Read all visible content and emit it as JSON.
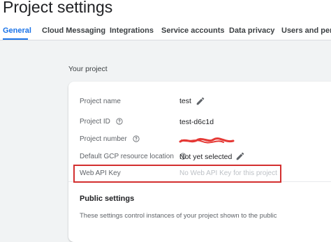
{
  "header": {
    "title": "Project settings",
    "tabs": [
      {
        "label": "General",
        "active": true
      },
      {
        "label": "Cloud Messaging"
      },
      {
        "label": "Integrations"
      },
      {
        "label": "Service accounts"
      },
      {
        "label": "Data privacy"
      },
      {
        "label": "Users and perm"
      }
    ]
  },
  "section": {
    "title": "Your project"
  },
  "project": {
    "name_label": "Project name",
    "name_value": "test",
    "id_label": "Project ID",
    "id_value": "test-d6c1d",
    "number_label": "Project number",
    "gcp_label": "Default GCP resource location",
    "gcp_value": "Not yet selected",
    "api_key_label": "Web API Key",
    "api_key_value": "No Web API Key for this project"
  },
  "public_settings": {
    "title": "Public settings",
    "description": "These settings control instances of your project shown to the public"
  },
  "colors": {
    "accent": "#1a73e8",
    "highlight_border": "#d32f2f",
    "redaction": "#e53935"
  },
  "icons": [
    "pencil-icon",
    "help-circle-icon"
  ]
}
